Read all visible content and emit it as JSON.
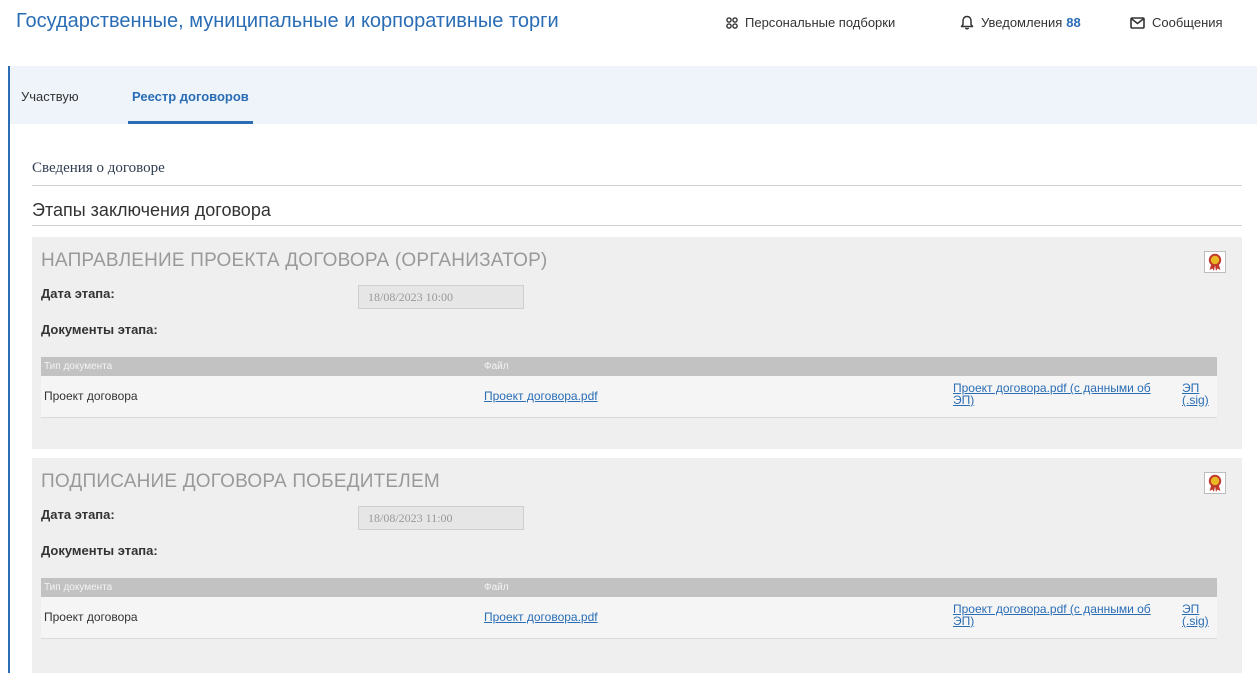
{
  "header": {
    "title": "Государственные, муниципальные и корпоративные торги",
    "nav": {
      "collections": "Персональные подборки",
      "notifications": "Уведомления",
      "notifications_count": "88",
      "messages": "Сообщения"
    }
  },
  "tabs": [
    {
      "label": "Участвую",
      "active": false
    },
    {
      "label": "Реестр договоров",
      "active": true
    }
  ],
  "sections": {
    "contract_info": "Сведения о договоре",
    "stages_title": "Этапы заключения договора"
  },
  "stages": [
    {
      "title": "НАПРАВЛЕНИЕ ПРОЕКТА ДОГОВОРА (ОРГАНИЗАТОР)",
      "date_label": "Дата этапа:",
      "date_value": "18/08/2023 10:00",
      "docs_label": "Документы этапа:",
      "table": {
        "headers": [
          "Тип документа",
          "Файл"
        ],
        "rows": [
          {
            "type": "Проект договора",
            "file": "Проект договора.pdf",
            "file_ep": "Проект договора.pdf (с данными об ЭП)",
            "sig": "ЭП (.sig)"
          }
        ]
      }
    },
    {
      "title": "ПОДПИСАНИЕ ДОГОВОРА ПОБЕДИТЕЛЕМ",
      "date_label": "Дата этапа:",
      "date_value": "18/08/2023 11:00",
      "docs_label": "Документы этапа:",
      "table": {
        "headers": [
          "Тип документа",
          "Файл"
        ],
        "rows": [
          {
            "type": "Проект договора",
            "file": "Проект договора.pdf",
            "file_ep": "Проект договора.pdf (с данными об ЭП)",
            "sig": "ЭП (.sig)"
          }
        ]
      }
    }
  ],
  "colors": {
    "accent": "#2a6db5",
    "tabbar_bg": "#eef4fa",
    "stage_bg": "#efefef",
    "table_header_bg": "#c2c2c2",
    "cert_icon": "#c0392b"
  }
}
